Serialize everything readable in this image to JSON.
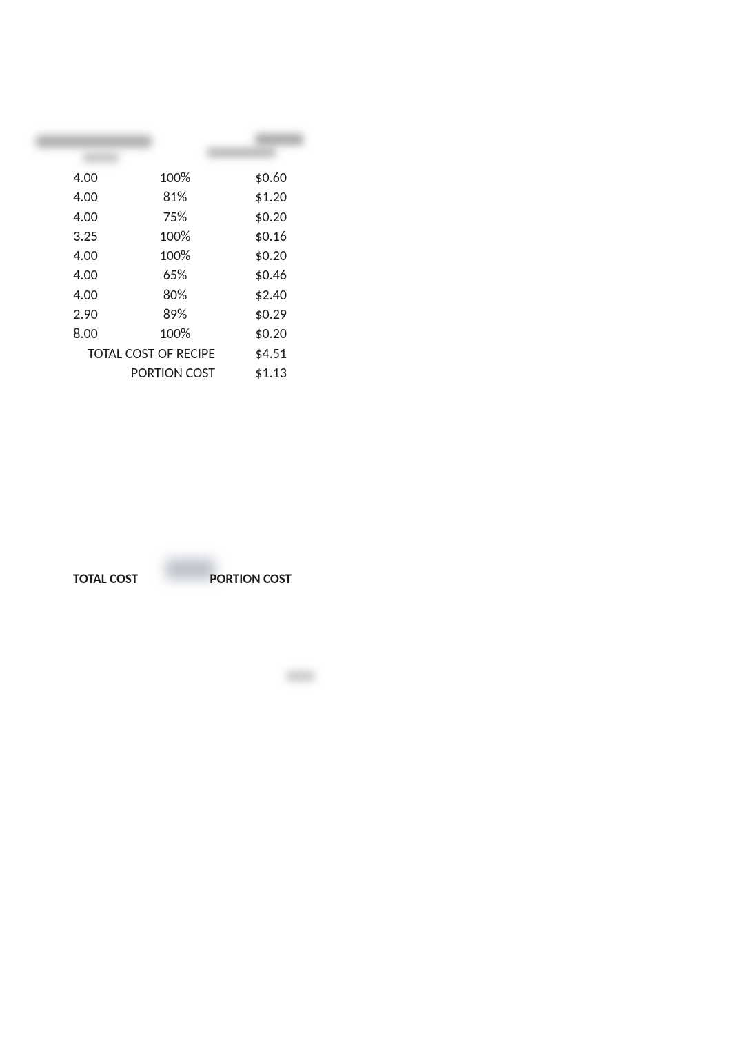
{
  "table": {
    "rows": [
      {
        "qty": "4.00",
        "pct": "100%",
        "cost": "$0.60"
      },
      {
        "qty": "4.00",
        "pct": "81%",
        "cost": "$1.20"
      },
      {
        "qty": "4.00",
        "pct": "75%",
        "cost": "$0.20"
      },
      {
        "qty": "3.25",
        "pct": "100%",
        "cost": "$0.16"
      },
      {
        "qty": "4.00",
        "pct": "100%",
        "cost": "$0.20"
      },
      {
        "qty": "4.00",
        "pct": "65%",
        "cost": "$0.46"
      },
      {
        "qty": "4.00",
        "pct": "80%",
        "cost": "$2.40"
      },
      {
        "qty": "2.90",
        "pct": "89%",
        "cost": "$0.29"
      },
      {
        "qty": "8.00",
        "pct": "100%",
        "cost": "$0.20"
      }
    ],
    "totals": {
      "recipe_label": "TOTAL COST OF RECIPE",
      "recipe_value": "$4.51",
      "portion_label": "PORTION COST",
      "portion_value": "$1.13"
    }
  },
  "lower": {
    "total_cost_label": "TOTAL COST",
    "portion_cost_label": "PORTION COST"
  }
}
